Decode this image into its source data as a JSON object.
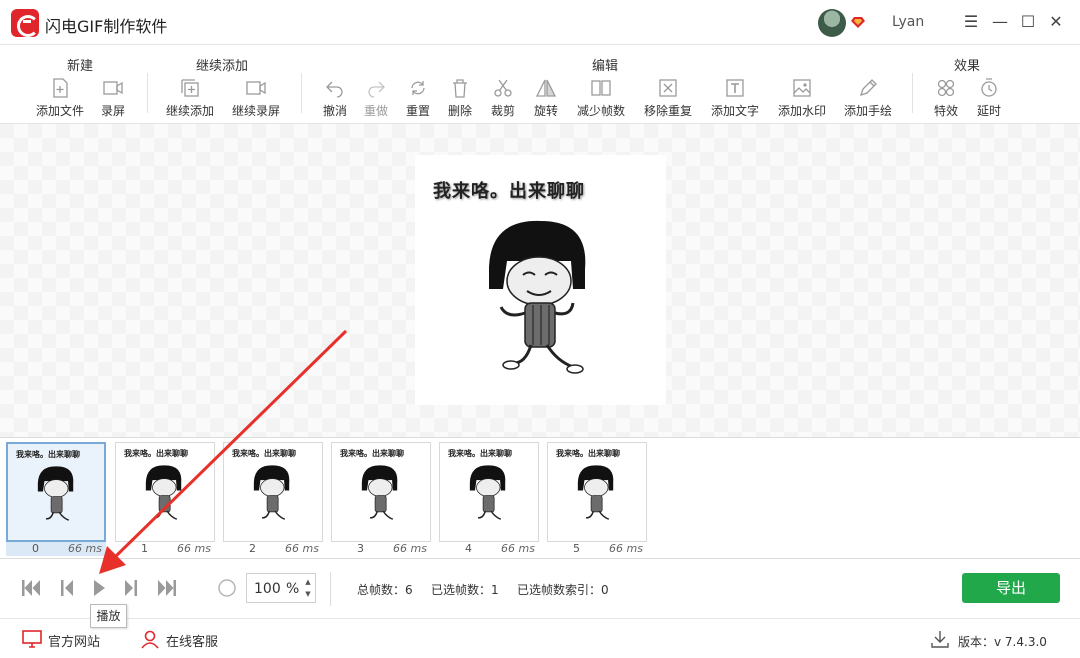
{
  "titlebar": {
    "app_title": "闪电GIF制作软件",
    "user_name": "Lyan",
    "min_glyph": "☰",
    "restore_glyph": "—",
    "max_glyph": "☐",
    "close_glyph": "✕"
  },
  "toolbar": {
    "groups": {
      "new": "新建",
      "continue_add": "继续添加",
      "edit": "编辑",
      "effects": "效果"
    },
    "tools": {
      "add_file": "添加文件",
      "record_screen": "录屏",
      "continue_add": "继续添加",
      "continue_record": "继续录屏",
      "undo": "撤消",
      "redo": "重做",
      "reset": "重置",
      "delete": "删除",
      "crop": "裁剪",
      "rotate": "旋转",
      "reduce_frames": "减少帧数",
      "remove_duplicates": "移除重复",
      "add_text": "添加文字",
      "add_watermark": "添加水印",
      "add_drawing": "添加手绘",
      "effects": "特效",
      "delay": "延时"
    }
  },
  "preview": {
    "caption": "我来咯。出来聊聊"
  },
  "frames": [
    {
      "index": "0",
      "ms": "66 ms",
      "caption": "我来咯。出来聊聊",
      "selected": true
    },
    {
      "index": "1",
      "ms": "66 ms",
      "caption": "我来咯。出来聊聊",
      "selected": false
    },
    {
      "index": "2",
      "ms": "66 ms",
      "caption": "我来咯。出来聊聊",
      "selected": false
    },
    {
      "index": "3",
      "ms": "66 ms",
      "caption": "我来咯。出来聊聊",
      "selected": false
    },
    {
      "index": "4",
      "ms": "66 ms",
      "caption": "我来咯。出来聊聊",
      "selected": false
    },
    {
      "index": "5",
      "ms": "66 ms",
      "caption": "我来咯。出来聊聊",
      "selected": false
    }
  ],
  "playback": {
    "zoom_value": "100",
    "zoom_unit": "%",
    "total_frames": "总帧数：6",
    "selected_frames": "已选帧数：1",
    "selected_index": "已选帧数索引：0",
    "export_label": "导出",
    "tooltip": "播放"
  },
  "footer": {
    "official_site": "官方网站",
    "online_support": "在线客服",
    "version": "版本：v 7.4.3.0"
  },
  "colors": {
    "accent": "#e0262b",
    "export": "#21a84b",
    "annotation_arrow": "#e8302b"
  }
}
